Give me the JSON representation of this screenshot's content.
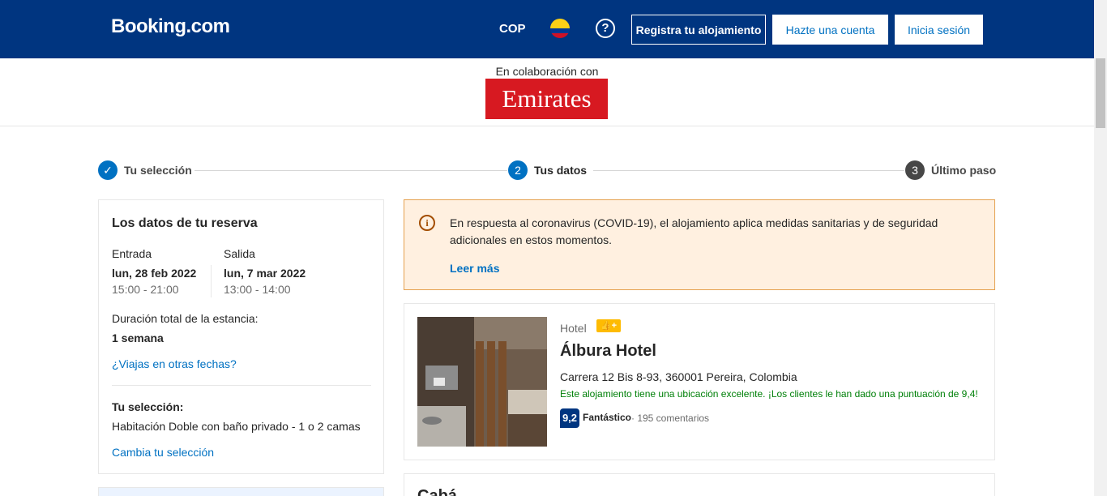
{
  "header": {
    "logo": "Booking.com",
    "currency": "COP",
    "help_symbol": "?",
    "register_property": "Registra tu alojamiento",
    "create_account": "Hazte una cuenta",
    "login": "Inicia sesión"
  },
  "partner": {
    "text": "En colaboración con",
    "brand": "Emirates"
  },
  "steps": [
    {
      "number": "✓",
      "label": "Tu selección"
    },
    {
      "number": "2",
      "label": "Tus datos"
    },
    {
      "number": "3",
      "label": "Último paso"
    }
  ],
  "booking_details": {
    "title": "Los datos de tu reserva",
    "checkin_label": "Entrada",
    "checkin_date": "lun, 28 feb 2022",
    "checkin_time": "15:00 - 21:00",
    "checkout_label": "Salida",
    "checkout_date": "lun, 7 mar 2022",
    "checkout_time": "13:00 - 14:00",
    "duration_label": "Duración total de la estancia:",
    "duration_value": "1 semana",
    "other_dates_link": "¿Viajas en otras fechas?",
    "selection_label": "Tu selección:",
    "selection_value": "Habitación Doble con baño privado - 1 o 2 camas",
    "change_selection_link": "Cambia tu selección"
  },
  "notice": {
    "icon": "i",
    "text": "En respuesta al coronavirus (COVID-19), el alojamiento aplica medidas sanitarias y de seguridad adicionales en estos momentos.",
    "link": "Leer más"
  },
  "hotel": {
    "type": "Hotel",
    "badge": "👍+",
    "name": "Álbura Hotel",
    "address": "Carrera 12 Bis 8-93, 360001 Pereira, Colombia",
    "location_note": "Este alojamiento tiene una ubicación excelente. ¡Los clientes le han dado una puntuación de 9,4!",
    "score": "9,2",
    "score_word": "Fantástico",
    "reviews": "· 195 comentarios"
  },
  "bottom_card": {
    "title": "Cabá..."
  },
  "colors": {
    "brand_dark_blue": "#003580",
    "link_blue": "#0071c2",
    "emirates_red": "#d71921",
    "notice_bg": "#fff0e0",
    "notice_border": "#e5a14f",
    "positive_green": "#008009",
    "badge_yellow": "#febb02"
  }
}
